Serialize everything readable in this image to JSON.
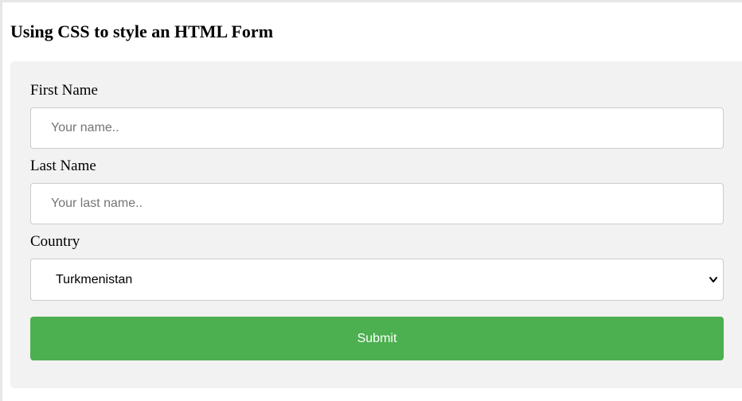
{
  "page": {
    "title": "Using CSS to style an HTML Form"
  },
  "form": {
    "first_name": {
      "label": "First Name",
      "value": "",
      "placeholder": "Your name.."
    },
    "last_name": {
      "label": "Last Name",
      "value": "",
      "placeholder": "Your last name.."
    },
    "country": {
      "label": "Country",
      "selected": "Turkmenistan",
      "icon": "chevron-down-icon"
    },
    "submit_label": "Submit"
  },
  "colors": {
    "panel_background": "#f2f2f2",
    "submit_background": "#4caf50",
    "submit_text": "#ffffff",
    "input_border": "#cccccc"
  }
}
